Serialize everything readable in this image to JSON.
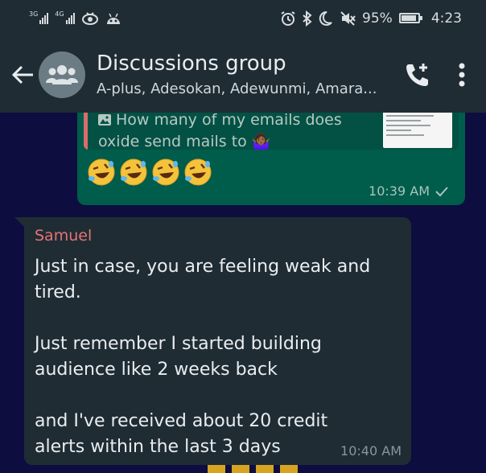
{
  "status_bar": {
    "net1": "3G",
    "net2": "4G",
    "battery_pct": "95%",
    "time": "4:23",
    "icons": [
      "signal-icon",
      "eye-icon",
      "robot-icon",
      "alarm-icon",
      "bluetooth-icon",
      "moon-icon",
      "mute-icon",
      "battery-icon"
    ]
  },
  "header": {
    "title": "Discussions group",
    "members": "A-plus, Adesokan, Adewunmi, Amara...",
    "icons": [
      "back-arrow-icon",
      "group-avatar-icon",
      "add-call-icon",
      "more-vert-icon"
    ]
  },
  "messages": [
    {
      "direction": "out",
      "quoted": {
        "text": "How many of my emails does oxide send mails to 🤷🏾‍♀️",
        "icon": "image-icon"
      },
      "body": "🤣🤣🤣🤣",
      "time": "10:39 AM",
      "status_icon": "check-icon"
    },
    {
      "direction": "in",
      "sender": "Samuel",
      "paragraphs": [
        "Just in case, you are feeling weak and tired.",
        "Just remember I started building audience like 2 weeks back",
        "and I've received about 20 credit alerts within the last 3 days"
      ],
      "time": "10:40 AM"
    }
  ],
  "colors": {
    "header_bg": "#1f2c34",
    "chat_bg": "#0d0d3f",
    "outgoing_bubble": "#005c4b",
    "incoming_bubble": "#1f2c34",
    "sender_name": "#e57373"
  }
}
